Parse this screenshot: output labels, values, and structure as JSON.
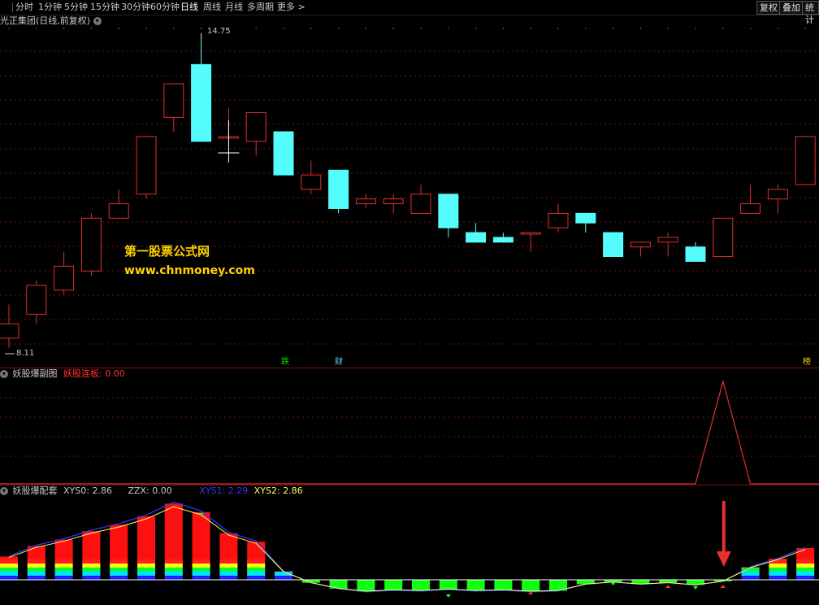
{
  "toolbar": {
    "periods": [
      "分时",
      "1分钟",
      "5分钟",
      "15分钟",
      "30分钟",
      "60分钟",
      "日线",
      "周线",
      "月线",
      "多周期",
      "更多 >"
    ],
    "active_period": "日线",
    "right_buttons": [
      "复权",
      "叠加",
      "统计"
    ]
  },
  "main_panel": {
    "title": "光正集团(日线,前复权)",
    "high_label": "14.75",
    "low_label": "8.11",
    "markers": [
      {
        "text": "跌",
        "color": "#00e000"
      },
      {
        "text": "财",
        "color": "#66ccff"
      },
      {
        "text": "榜",
        "color": "#ffcc00"
      }
    ],
    "watermark_title": "第一股票公式网",
    "watermark_url": "www.chnmoney.com",
    "colors": {
      "up": "#e03030",
      "down": "#54fcfc",
      "grid": "#7a1010",
      "crosshair": "#ffffff"
    }
  },
  "sub_panel_1": {
    "name": "妖股爆副图",
    "indicator_label": "妖股连板:",
    "indicator_value": "0.00",
    "indicator_color": "#ff3030"
  },
  "sub_panel_2": {
    "name": "妖股爆配套",
    "items": [
      {
        "label": "XYS0:",
        "value": "2.86",
        "color": "#c8c8c8"
      },
      {
        "label": "ZZX:",
        "value": "0.00",
        "color": "#c8c8c8"
      },
      {
        "label": "XYS1:",
        "value": "2.29",
        "color": "#2e3aff"
      },
      {
        "label": "XYS2:",
        "value": "2.86",
        "color": "#ffff60"
      }
    ]
  },
  "chart_data": {
    "type": "candlestick",
    "price_range": [
      8.11,
      14.75
    ],
    "candles": [
      {
        "o": 8.4,
        "c": 8.7,
        "h": 9.1,
        "l": 8.2
      },
      {
        "o": 8.9,
        "c": 9.5,
        "h": 9.6,
        "l": 8.7
      },
      {
        "o": 9.4,
        "c": 9.9,
        "h": 10.2,
        "l": 9.3
      },
      {
        "o": 9.8,
        "c": 10.9,
        "h": 11.0,
        "l": 9.7
      },
      {
        "o": 10.9,
        "c": 11.2,
        "h": 11.5,
        "l": 10.9
      },
      {
        "o": 11.4,
        "c": 12.6,
        "h": 12.6,
        "l": 11.3
      },
      {
        "o": 13.0,
        "c": 13.7,
        "h": 13.7,
        "l": 12.7
      },
      {
        "o": 14.1,
        "c": 12.5,
        "h": 14.75,
        "l": 12.5
      },
      {
        "o": 12.6,
        "c": 12.6,
        "h": 13.2,
        "l": 12.4
      },
      {
        "o": 12.5,
        "c": 13.1,
        "h": 13.1,
        "l": 12.2
      },
      {
        "o": 12.7,
        "c": 11.8,
        "h": 12.7,
        "l": 11.8
      },
      {
        "o": 11.5,
        "c": 11.8,
        "h": 12.1,
        "l": 11.4
      },
      {
        "o": 11.9,
        "c": 11.1,
        "h": 11.9,
        "l": 11.0
      },
      {
        "o": 11.2,
        "c": 11.3,
        "h": 11.4,
        "l": 11.1
      },
      {
        "o": 11.2,
        "c": 11.3,
        "h": 11.4,
        "l": 11.0
      },
      {
        "o": 11.0,
        "c": 11.4,
        "h": 11.6,
        "l": 11.0
      },
      {
        "o": 11.4,
        "c": 10.7,
        "h": 11.4,
        "l": 10.5
      },
      {
        "o": 10.6,
        "c": 10.4,
        "h": 10.8,
        "l": 10.4
      },
      {
        "o": 10.5,
        "c": 10.4,
        "h": 10.6,
        "l": 10.4
      },
      {
        "o": 10.6,
        "c": 10.6,
        "h": 10.6,
        "l": 10.2
      },
      {
        "o": 10.7,
        "c": 11.0,
        "h": 11.2,
        "l": 10.6
      },
      {
        "o": 11.0,
        "c": 10.8,
        "h": 11.0,
        "l": 10.6
      },
      {
        "o": 10.6,
        "c": 10.1,
        "h": 10.6,
        "l": 10.1
      },
      {
        "o": 10.3,
        "c": 10.4,
        "h": 10.4,
        "l": 10.1
      },
      {
        "o": 10.4,
        "c": 10.5,
        "h": 10.6,
        "l": 10.1
      },
      {
        "o": 10.3,
        "c": 10.0,
        "h": 10.4,
        "l": 10.0
      },
      {
        "o": 10.1,
        "c": 10.9,
        "h": 10.9,
        "l": 10.1
      },
      {
        "o": 11.0,
        "c": 11.2,
        "h": 11.6,
        "l": 11.0
      },
      {
        "o": 11.3,
        "c": 11.5,
        "h": 11.6,
        "l": 11.0
      },
      {
        "o": 11.6,
        "c": 12.6,
        "h": 12.6,
        "l": 11.6
      }
    ],
    "sub1_series": {
      "name": "妖股连板",
      "values": [
        0,
        0,
        0,
        0,
        0,
        0,
        0,
        0,
        0,
        0,
        0,
        0,
        0,
        0,
        0,
        0,
        0,
        0,
        0,
        0,
        0,
        0,
        0,
        0,
        0,
        0,
        1,
        0,
        0,
        0
      ]
    },
    "sub2_bars": [
      1.1,
      1.6,
      1.9,
      2.3,
      2.6,
      3.0,
      3.6,
      3.2,
      2.2,
      1.8,
      0.4,
      -0.4,
      -1.2,
      -1.6,
      -1.4,
      -1.5,
      -1.3,
      -1.5,
      -1.4,
      -1.6,
      -1.5,
      -0.6,
      -0.3,
      -0.6,
      -0.4,
      -0.7,
      -0.2,
      0.6,
      1.0,
      1.5
    ]
  }
}
